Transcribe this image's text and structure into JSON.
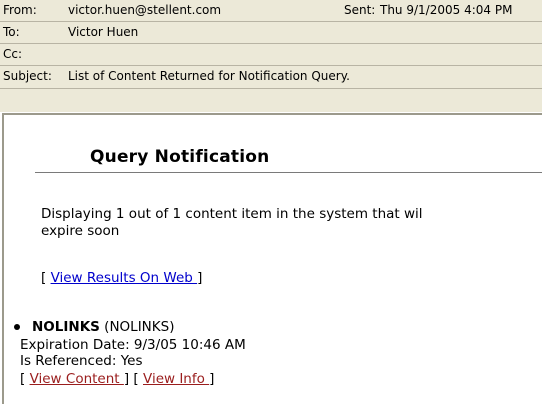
{
  "header": {
    "from_label": "From:",
    "from_value": "victor.huen@stellent.com",
    "sent_label": "Sent:",
    "sent_value": "Thu 9/1/2005 4:04 PM",
    "to_label": "To:",
    "to_value": "Victor Huen",
    "cc_label": "Cc:",
    "cc_value": "",
    "subject_label": "Subject:",
    "subject_value": "List of Content Returned for Notification Query."
  },
  "body": {
    "title": "Query Notification",
    "message_line1": "Displaying 1 out of 1 content item in the system that wil",
    "message_line2": "expire soon",
    "view_results_prefix": "[ ",
    "view_results_link": "View Results On Web ",
    "view_results_suffix": "]",
    "item": {
      "name": "NOLINKS",
      "id": " (NOLINKS)",
      "expiration": "Expiration Date: 9/3/05 10:46 AM",
      "referenced": "Is Referenced: Yes",
      "link_open": "[ ",
      "view_content_link": "View Content ",
      "link_mid": "] [ ",
      "view_info_link": "View Info ",
      "link_close": "]"
    }
  }
}
